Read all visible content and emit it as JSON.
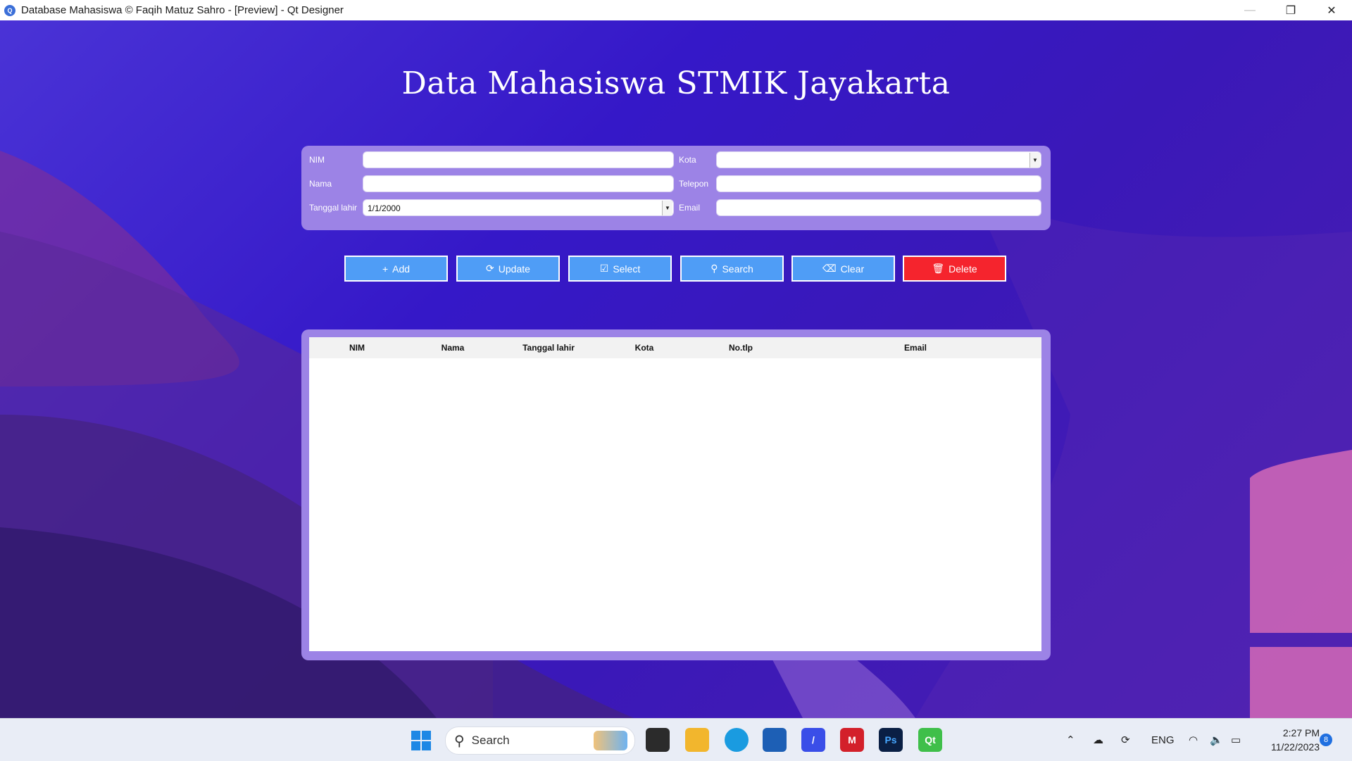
{
  "window": {
    "title": "Database Mahasiswa © Faqih Matuz Sahro - [Preview] - Qt Designer",
    "minimize": "—",
    "restore": "❐",
    "close": "✕"
  },
  "app": {
    "heading": "Data Mahasiswa STMIK Jayakarta"
  },
  "form": {
    "nim_label": "NIM",
    "nama_label": "Nama",
    "tanggal_label": "Tanggal lahir",
    "tanggal_value": "1/1/2000",
    "kota_label": "Kota",
    "telepon_label": "Telepon",
    "email_label": "Email"
  },
  "buttons": {
    "add": "Add",
    "update": "Update",
    "select": "Select",
    "search": "Search",
    "clear": "Clear",
    "delete": "Delete"
  },
  "table": {
    "columns": [
      "NIM",
      "Nama",
      "Tanggal lahir",
      "Kota",
      "No.tlp",
      "Email"
    ],
    "rows": []
  },
  "taskbar": {
    "search_placeholder": "Search",
    "tray_language": "ENG",
    "time": "2:27 PM",
    "date": "11/22/2023",
    "notification_count": "8"
  },
  "colors": {
    "button_blue": "#4f9df6",
    "button_red": "#f5242d",
    "panel": "#9c83e6"
  }
}
